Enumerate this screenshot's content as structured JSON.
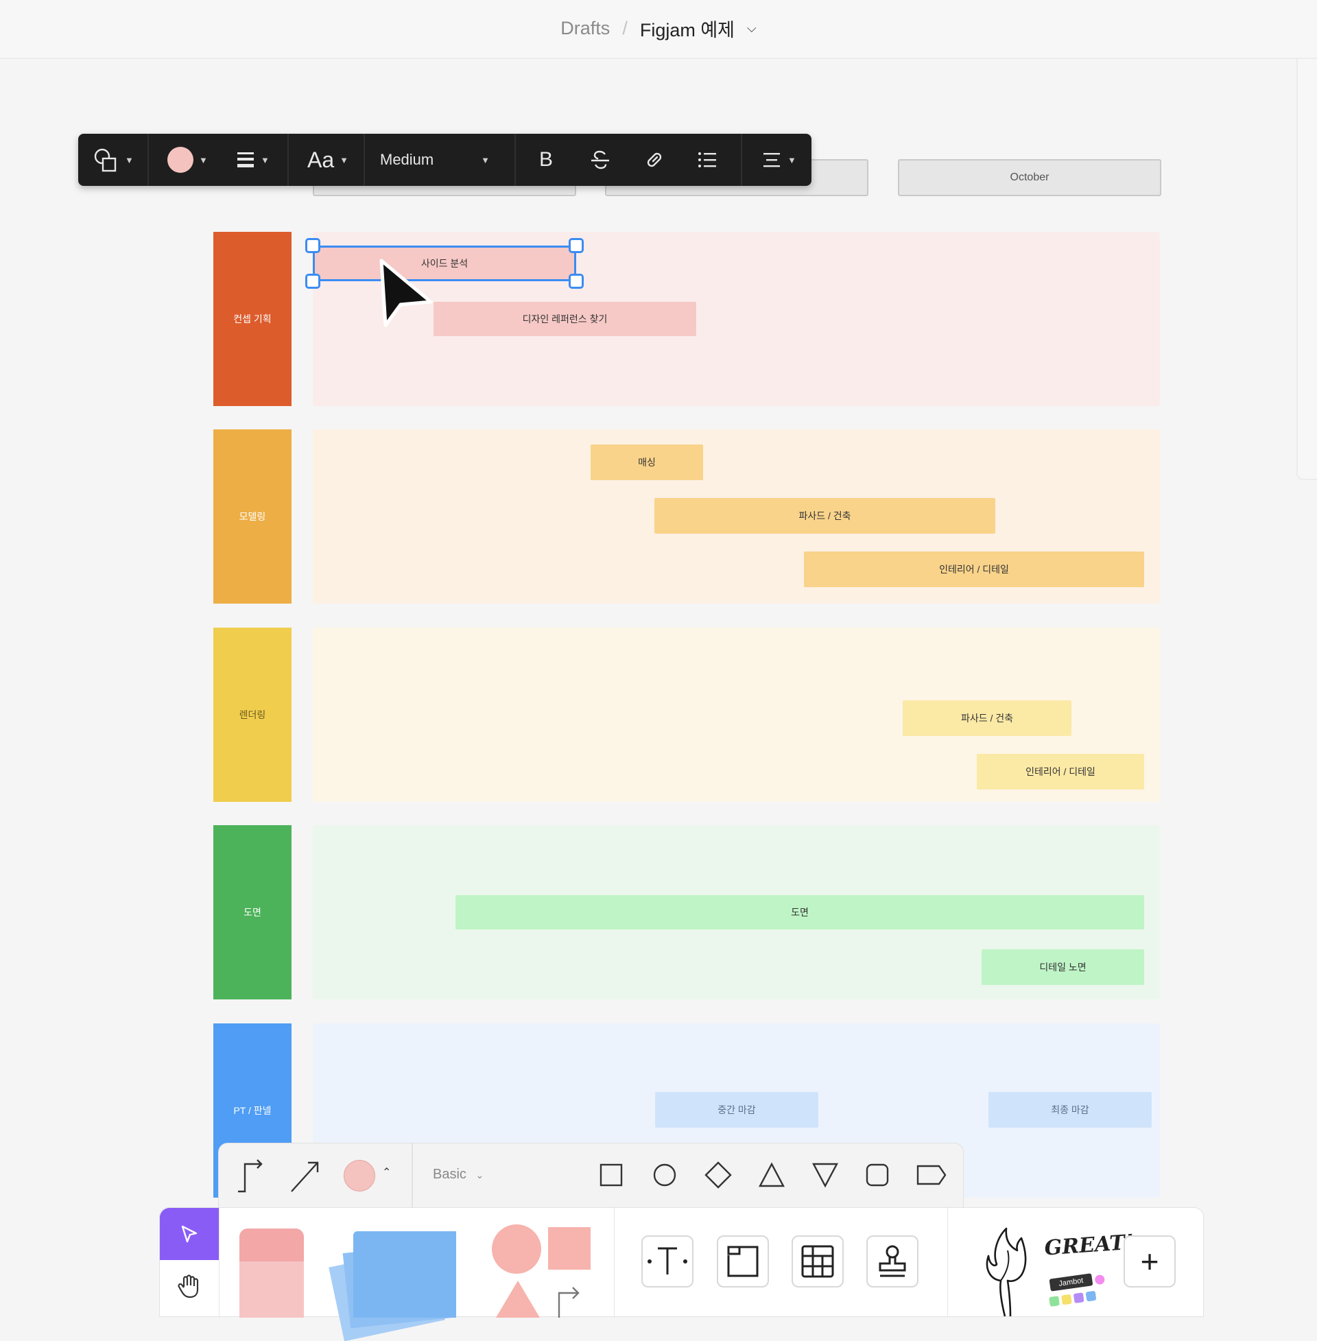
{
  "header": {
    "drafts": "Drafts",
    "separator": "/",
    "file_name": "Figjam 예제",
    "chevron": "⌄"
  },
  "toolbar": {
    "font_label": "Aa",
    "weight": "Medium",
    "bold": "B",
    "fill_color": "#f4c3c0",
    "icons": [
      "shape-icon",
      "color-icon",
      "stroke-icon",
      "font-icon",
      "bold-icon",
      "strikethrough-icon",
      "link-icon",
      "list-icon",
      "align-icon"
    ]
  },
  "months": [
    "",
    "",
    "October"
  ],
  "lanes": [
    {
      "label": "컨셉 기획",
      "color": "#dd5c2c",
      "bg": "#fbecec",
      "tasks": [
        {
          "label": "사이드 분석",
          "color": "#f6c9c6"
        },
        {
          "label": "디자인 레퍼런스 찾기",
          "color": "#f6c9c6"
        }
      ]
    },
    {
      "label": "모델링",
      "color": "#edae46",
      "bg": "#fdf1e4",
      "tasks": [
        {
          "label": "매싱",
          "color": "#f9d38a"
        },
        {
          "label": "파사드 / 건축",
          "color": "#f9d38a"
        },
        {
          "label": "인테리어 / 디테일",
          "color": "#f9d38a"
        }
      ]
    },
    {
      "label": "렌더링",
      "color": "#f0cd4c",
      "bg": "#fdf6e6",
      "tasks": [
        {
          "label": "파사드 / 건축",
          "color": "#fbe9a6"
        },
        {
          "label": "인테리어 / 디테일",
          "color": "#fbe9a6"
        }
      ]
    },
    {
      "label": "도면",
      "color": "#4cb35a",
      "bg": "#ebf7ec",
      "tasks": [
        {
          "label": "도면",
          "color": "#bff4c6"
        },
        {
          "label": "디테일 노면",
          "color": "#bff4c6"
        }
      ]
    },
    {
      "label": "PT / 판넬",
      "color": "#4f9df4",
      "bg": "#edf3fc",
      "tasks": [
        {
          "label": "중간 마감",
          "color": "#cfe4fb"
        },
        {
          "label": "최종 마감",
          "color": "#cfe4fb"
        }
      ]
    }
  ],
  "shapebar": {
    "style": "Basic",
    "fill_color": "#f4c3c0"
  },
  "mainbar": {
    "sticker_text": "GREAT!",
    "jambot": "Jambot",
    "add": "+"
  },
  "colors": {
    "selection": "#3b8cf2",
    "cursor_tool": "#8a5cf6"
  }
}
